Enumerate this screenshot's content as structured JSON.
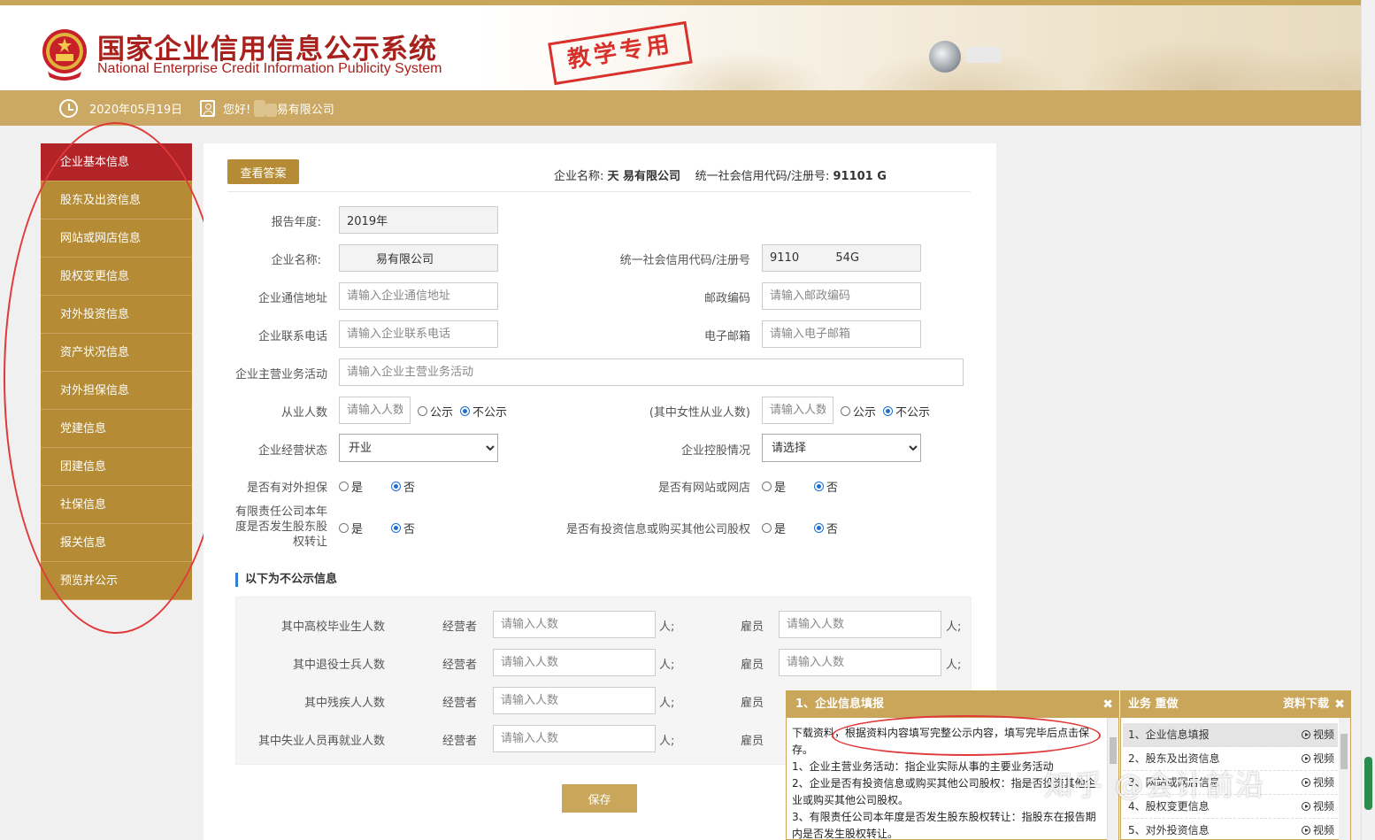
{
  "header": {
    "title_cn": "国家企业信用信息公示系统",
    "title_en": "National Enterprise Credit Information Publicity System",
    "stamp": "教学专用"
  },
  "infobar": {
    "date": "2020年05月19日",
    "greeting_prefix": "您好! ",
    "greeting_masked": "天",
    "greeting_suffix": "易有限公司"
  },
  "sidebar": {
    "items": [
      {
        "label": "企业基本信息"
      },
      {
        "label": "股东及出资信息"
      },
      {
        "label": "网站或网店信息"
      },
      {
        "label": "股权变更信息"
      },
      {
        "label": "对外投资信息"
      },
      {
        "label": "资产状况信息"
      },
      {
        "label": "对外担保信息"
      },
      {
        "label": "党建信息"
      },
      {
        "label": "团建信息"
      },
      {
        "label": "社保信息"
      },
      {
        "label": "报关信息"
      },
      {
        "label": "预览并公示"
      }
    ]
  },
  "main": {
    "answer_button": "查看答案",
    "company_label": "企业名称:",
    "company_name": "天   易有限公司",
    "credit_label": "统一社会信用代码/注册号:",
    "credit_code": "91101               G",
    "form": {
      "report_year_label": "报告年度:",
      "report_year_value": "2019年",
      "name_label": "企业名称:",
      "name_value": "        易有限公司",
      "code_label": "统一社会信用代码/注册号",
      "code_value": "9110          54G",
      "address_label": "企业通信地址",
      "address_placeholder": "请输入企业通信地址",
      "postcode_label": "邮政编码",
      "postcode_placeholder": "请输入邮政编码",
      "phone_label": "企业联系电话",
      "phone_placeholder": "请输入企业联系电话",
      "email_label": "电子邮箱",
      "email_placeholder": "请输入电子邮箱",
      "business_label": "企业主营业务活动",
      "business_placeholder": "请输入企业主营业务活动",
      "employees_label": "从业人数",
      "employees_placeholder": "请输入人数",
      "female_label": "(其中女性从业人数)",
      "female_placeholder": "请输入人数",
      "public_option": "公示",
      "private_option": "不公示",
      "status_label": "企业经营状态",
      "status_value": "开业",
      "holding_label": "企业控股情况",
      "holding_value": "请选择",
      "guarantee_label": "是否有对外担保",
      "website_label": "是否有网站或网店",
      "transfer_label_1": "有限责任公司本年",
      "transfer_label_2": "度是否发生股东股",
      "transfer_label_3": "权转让",
      "invest_label": "是否有投资信息或购买其他公司股权",
      "yes": "是",
      "no": "否"
    },
    "nonpublic": {
      "title": "以下为不公示信息",
      "operator_label": "经营者",
      "employee_label": "雇员",
      "unit": "人;",
      "placeholder": "请输入人数",
      "rows": [
        {
          "label": "其中高校毕业生人数"
        },
        {
          "label": "其中退役士兵人数"
        },
        {
          "label": "其中残疾人人数"
        },
        {
          "label": "其中失业人员再就业人数"
        }
      ]
    },
    "save_button": "保存"
  },
  "popup_guide": {
    "title": "1、企业信息填报",
    "lines": [
      "下载资料，根据资料内容填写完整公示内容，填写完毕后点击保",
      "存。",
      "1、企业主营业务活动：指企业实际从事的主要业务活动",
      "2、企业是否有投资信息或购买其他公司股权：指是否投资其他企",
      "业或购买其他公司股权。",
      "3、有限责任公司本年度是否发生股东股权转让：指股东在报告期",
      "内是否发生股权转让。"
    ]
  },
  "popup_tasks": {
    "title": "业务  重做",
    "download": "资料下载",
    "video_label": "视频",
    "items": [
      {
        "label": "1、企业信息填报"
      },
      {
        "label": "2、股东及出资信息"
      },
      {
        "label": "3、网站或网店信息"
      },
      {
        "label": "4、股权变更信息"
      },
      {
        "label": "5、对外投资信息"
      }
    ]
  },
  "watermark": "知乎 @会计前沿",
  "colors": {
    "gold": "#b58c35",
    "active_red": "#b22427",
    "title_red": "#a8211c",
    "annotation_red": "#e0393a"
  }
}
